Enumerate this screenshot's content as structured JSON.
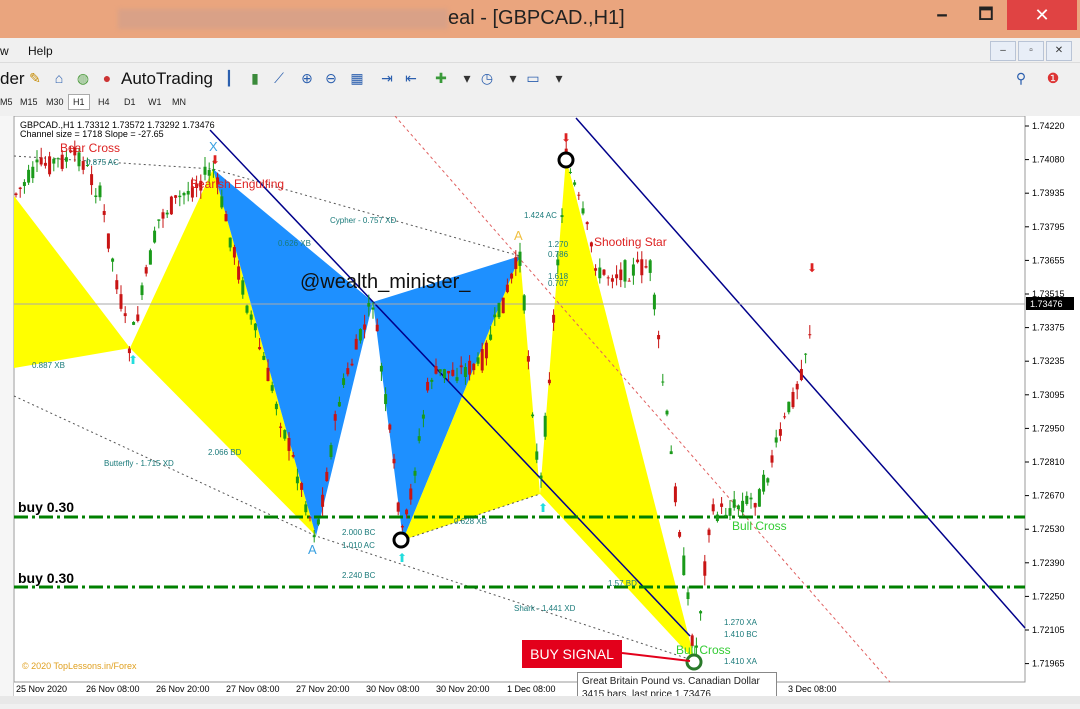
{
  "window": {
    "title": "eal - [GBPCAD.,H1]",
    "minimize": "🗕",
    "maximize": "🗖",
    "close": "✕"
  },
  "menu": {
    "items": [
      "w",
      "Help"
    ]
  },
  "toolbar": {
    "left_label": "der",
    "autotrading": "AutoTrading"
  },
  "timeframes": [
    "M5",
    "M15",
    "M30",
    "H1",
    "H4",
    "D1",
    "W1",
    "MN"
  ],
  "chart": {
    "header_symbol": "GBPCAD.,H1  1.73312 1.73572 1.73292 1.73476",
    "channel_info": "Channel size = 1718 Slope = -27.65",
    "watermark": "@wealth_minister_",
    "copyright": "© 2020 TopLessons.in/Forex",
    "current_price": "1.73476",
    "price_ticks": [
      "1.74220",
      "1.74080",
      "1.73935",
      "1.73795",
      "1.73655",
      "1.73515",
      "1.73375",
      "1.73235",
      "1.73095",
      "1.72950",
      "1.72810",
      "1.72670",
      "1.72530",
      "1.72390",
      "1.72250",
      "1.72105",
      "1.71965"
    ],
    "time_ticks": [
      "25 Nov 2020",
      "26 Nov 08:00",
      "26 Nov 20:00",
      "27 Nov 08:00",
      "27 Nov 20:00",
      "30 Nov 08:00",
      "30 Nov 20:00",
      "1 Dec 08:00",
      "3 Dec 08:00"
    ],
    "labels": {
      "bear_cross": "Bear Cross",
      "bearish_engulfing": "Bearish Engulfing",
      "shooting_star": "Shooting Star",
      "bull_cross_1": "Bull Cross",
      "bull_cross_2": "Bull Cross",
      "cypher": "Cypher - 0.757 XD",
      "butterfly": "Butterfly - 1.715 XD",
      "shark": "Shark - 1.441 XD",
      "xb_0626": "0.626 XB",
      "xb_0887": "0.887 XB",
      "bd_2066": "2.066 BD",
      "ac_1424": "1.424 AC",
      "ac_1010": "1.010 AC",
      "bc_2000": "2.000 BC",
      "bc_2240": "2.240 BC",
      "xa_1270": "1.270 XA",
      "bc_1410": "1.410 BC",
      "xa_1410": "1.410 XA",
      "xb_0628": "0.628 XB",
      "ac_0875": "0.875 AC",
      "v_1270": "1.270",
      "v_0786": "0.786",
      "v_1618": "1.618",
      "v_0707": "0.707",
      "v_158bd": "1.57 BD",
      "pt_x": "X",
      "pt_a1": "A",
      "pt_a2": "A"
    },
    "buy_levels": [
      "buy 0.30",
      "buy 0.30"
    ]
  },
  "buy_signal": "BUY SIGNAL",
  "tooltip": {
    "line1": "Great Britain Pound vs. Canadian Dollar",
    "line2": "3415 bars, last price 1.73476"
  },
  "colors": {
    "title_bg": "#eaa57e",
    "close_bg": "#e04343",
    "fill_yellow": "#ffff00",
    "fill_blue": "#1e90ff",
    "channel": "#00008b",
    "buy_line": "#008000",
    "signal_red": "#e3001b"
  }
}
